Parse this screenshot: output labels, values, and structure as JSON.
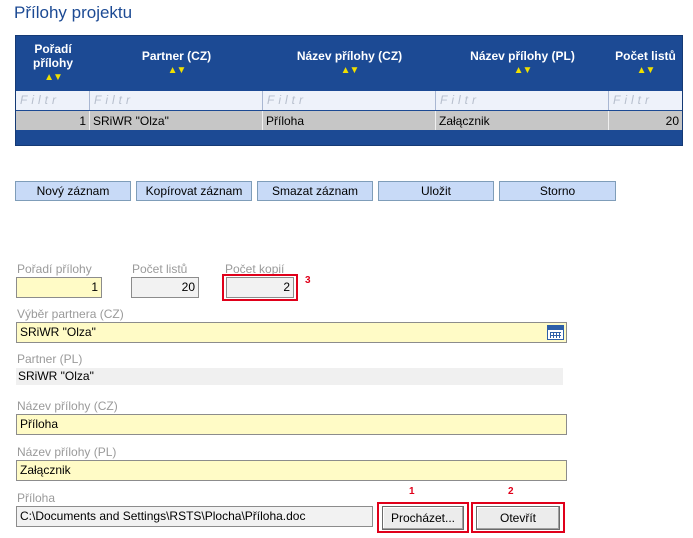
{
  "page_title": "Přílohy projektu",
  "grid": {
    "columns": [
      {
        "line1": "Pořadí",
        "line2": "přílohy"
      },
      {
        "line1": "Partner (CZ)",
        "line2": ""
      },
      {
        "line1": "Název přílohy (CZ)",
        "line2": ""
      },
      {
        "line1": "Název přílohy (PL)",
        "line2": ""
      },
      {
        "line1": "Počet listů",
        "line2": ""
      }
    ],
    "sort_glyph": "▲▼",
    "filter_placeholder": "Filtr",
    "row": {
      "poradi": "1",
      "partner": "SRiWR \"Olza\"",
      "nazev_cz": "Příloha",
      "nazev_pl": "Załącznik",
      "pocet_listu": "20"
    }
  },
  "toolbar": {
    "new_label": "Nový záznam",
    "copy_label": "Kopírovat záznam",
    "delete_label": "Smazat záznam",
    "save_label": "Uložit",
    "cancel_label": "Storno"
  },
  "form": {
    "poradi_label": "Pořadí přílohy",
    "poradi_value": "1",
    "pocet_listu_label": "Počet listů",
    "pocet_listu_value": "20",
    "pocet_kopii_label": "Počet kopií",
    "pocet_kopii_value": "2",
    "partner_select_label": "Výběr partnera (CZ)",
    "partner_select_value": "SRiWR \"Olza\"",
    "partner_pl_label": "Partner (PL)",
    "partner_pl_value": "SRiWR \"Olza\"",
    "nazev_cz_label": "Název přílohy (CZ)",
    "nazev_cz_value": "Příloha",
    "nazev_pl_label": "Název přílohy (PL)",
    "nazev_pl_value": "Załącznik",
    "priloha_label": "Příloha",
    "priloha_value": "C:\\Documents and Settings\\RSTS\\Plocha\\Příloha.doc",
    "browse_label": "Procházet...",
    "open_label": "Otevřít"
  },
  "annotations": {
    "browse_number": "1",
    "open_number": "2",
    "copies_number": "3"
  },
  "colors": {
    "grid_header": "#1c4a94",
    "accent_title": "#1c4a94",
    "sort_arrows": "#f0e000",
    "input_yellow": "#fffbc6",
    "highlight_red": "#e0001a",
    "button_blue": "#c8daf7"
  }
}
